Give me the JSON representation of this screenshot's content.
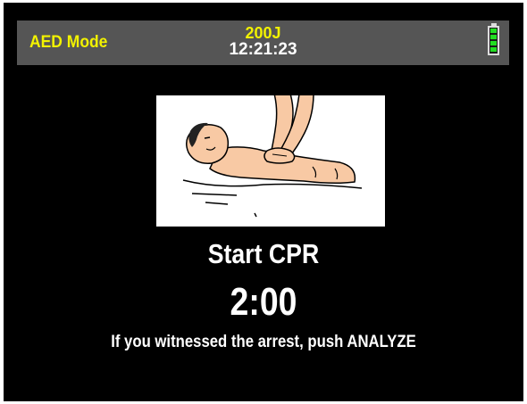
{
  "status_bar": {
    "mode": "AED Mode",
    "energy": "200J",
    "time": "12:21:23",
    "battery_icon": "battery-full-icon",
    "battery_level_fraction": 1.0,
    "battery_color": "#22dd22"
  },
  "illustration": {
    "icon": "cpr-chest-compression-illustration"
  },
  "main": {
    "title": "Start CPR",
    "timer": "2:00",
    "instruction": "If you witnessed the arrest, push ANALYZE"
  },
  "colors": {
    "background": "#000000",
    "status_bar": "#555555",
    "accent_yellow": "#f2f200",
    "text": "#ffffff"
  }
}
